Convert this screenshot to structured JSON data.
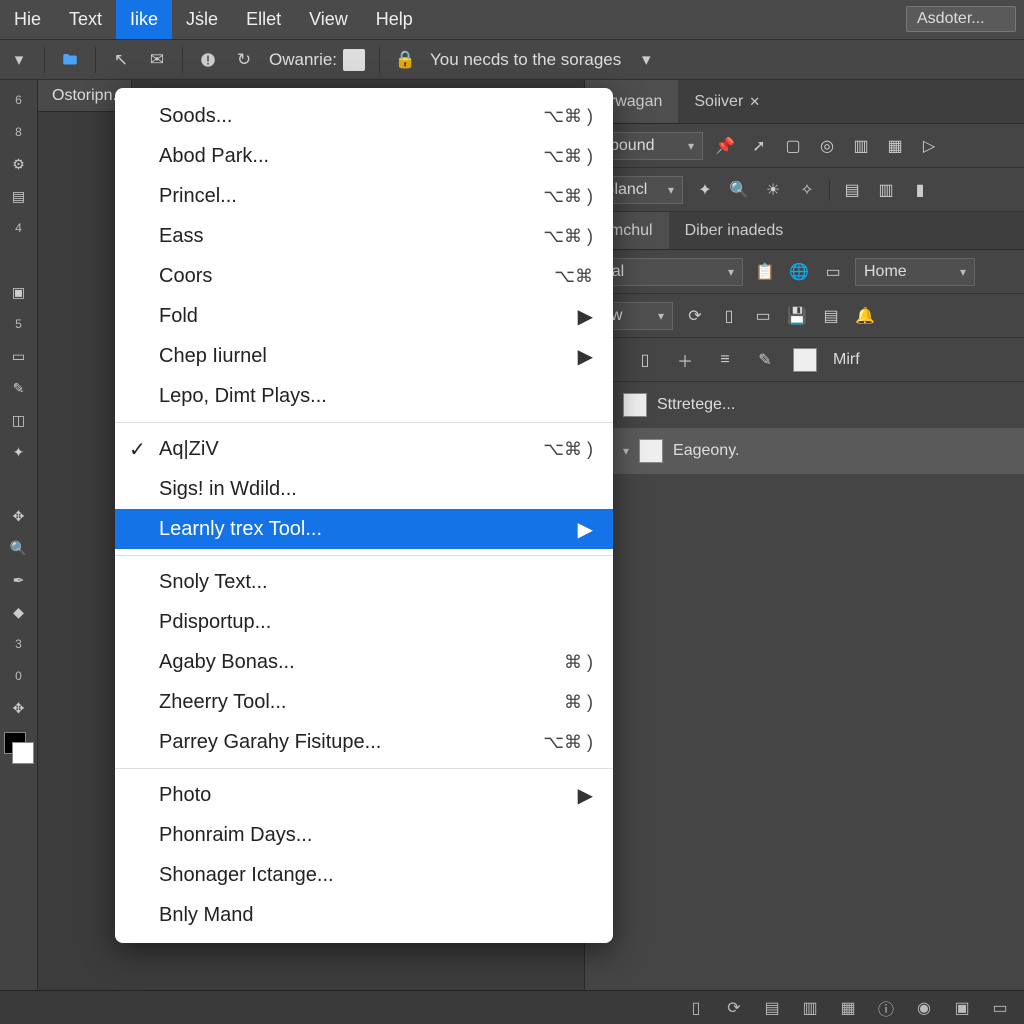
{
  "menubar": {
    "items": [
      {
        "label": "Hie"
      },
      {
        "label": "Text"
      },
      {
        "label": "Iіke",
        "active": true
      },
      {
        "label": "Jṡle"
      },
      {
        "label": "Ellet"
      },
      {
        "label": "View"
      },
      {
        "label": "Help"
      }
    ],
    "search_placeholder": "Asdoter..."
  },
  "toolbar": {
    "owanrie_label": "Owanrie:",
    "storage_msg": "You necds to the sorages"
  },
  "tabs": {
    "doc": "Ostoripn."
  },
  "right": {
    "panel_tabs": [
      {
        "label": "orwagan"
      },
      {
        "label": "Soiіver",
        "close": true
      }
    ],
    "row1_dd": "sbound",
    "row2_dd": "Glancl",
    "sub_tabs": [
      {
        "label": "emchul",
        "active": true
      },
      {
        "label": "Dіber inadeds"
      }
    ],
    "row3_dd": "tral",
    "row3_home": "Home",
    "row4_dd": "ew",
    "row5_label": "Mirf",
    "layers": [
      {
        "label": "Sttretege..."
      },
      {
        "label": "Eageony."
      }
    ]
  },
  "dropdown": {
    "groups": [
      [
        {
          "label": "Soods...",
          "shortcut": "⌥⌘ )"
        },
        {
          "label": "Abod Park...",
          "shortcut": "⌥⌘ )"
        },
        {
          "label": "Princel...",
          "shortcut": "⌥⌘ )"
        },
        {
          "label": "Eass",
          "shortcut": "⌥⌘ )"
        },
        {
          "label": "Coors",
          "shortcut": "⌥⌘"
        },
        {
          "label": "Fold",
          "submenu": true
        },
        {
          "label": "Chep Iіurnel",
          "submenu": true
        },
        {
          "label": "Lepo, Dimt Plays..."
        }
      ],
      [
        {
          "label": "Aq|ZіV",
          "shortcut": "⌥⌘ )",
          "checked": true
        },
        {
          "label": "Sigs! in Wdіld..."
        },
        {
          "label": "Learnly trex Tool...",
          "submenu": true,
          "highlight": true
        }
      ],
      [
        {
          "label": "Snoly Text..."
        },
        {
          "label": "Pdisportup..."
        },
        {
          "label": "Agaby Bonas...",
          "shortcut": "⌘ )"
        },
        {
          "label": "Zheerry Tool...",
          "shortcut": "⌘ )"
        },
        {
          "label": "Parrey Garahy Fisitupe...",
          "shortcut": "⌥⌘ )"
        }
      ],
      [
        {
          "label": "Photo",
          "submenu": true
        },
        {
          "label": "Phonraim Days..."
        },
        {
          "label": "Shonager Iсtange..."
        },
        {
          "label": "Bnly Mand"
        }
      ]
    ]
  },
  "left_tools": [
    "6",
    "8",
    "",
    "",
    "4",
    "",
    "",
    "5",
    "",
    "",
    "",
    "",
    "",
    "",
    "",
    "",
    "",
    "3",
    "0",
    ""
  ],
  "colors": {
    "accent": "#1473e6",
    "bg": "#4a4a4a"
  }
}
